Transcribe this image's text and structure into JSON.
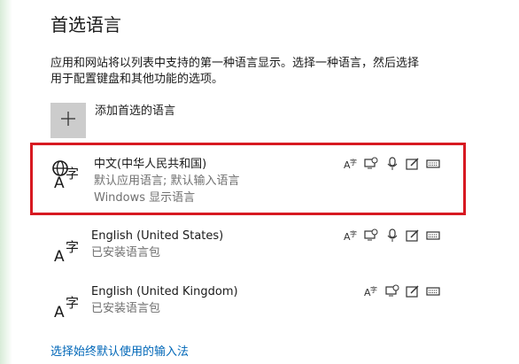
{
  "section_title": "首选语言",
  "description_line1": "应用和网站将以列表中支持的第一种语言显示。选择一种语言，然后选择",
  "description_line2": "用于配置键盘和其他功能的选项。",
  "add_language_label": "添加首选的语言",
  "languages": [
    {
      "name": "中文(中华人民共和国)",
      "line1": "默认应用语言; 默认输入语言",
      "line2": "Windows 显示语言",
      "features": [
        "text-to-speech-icon",
        "speech-recognition-icon",
        "microphone-icon",
        "handwriting-icon",
        "keyboard-icon"
      ]
    },
    {
      "name": "English (United States)",
      "line1": "已安装语言包",
      "features": [
        "text-to-speech-icon",
        "speech-recognition-icon",
        "microphone-icon",
        "handwriting-icon",
        "keyboard-icon"
      ]
    },
    {
      "name": "English (United Kingdom)",
      "line1": "已安装语言包",
      "features": [
        "text-to-speech-icon",
        "speech-recognition-icon",
        "handwriting-icon",
        "keyboard-icon"
      ]
    }
  ],
  "input_method_link": "选择始终默认使用的输入法",
  "colors": {
    "selection_border": "#d71921",
    "link": "#0067b8",
    "add_button_bg": "#cccccc"
  }
}
